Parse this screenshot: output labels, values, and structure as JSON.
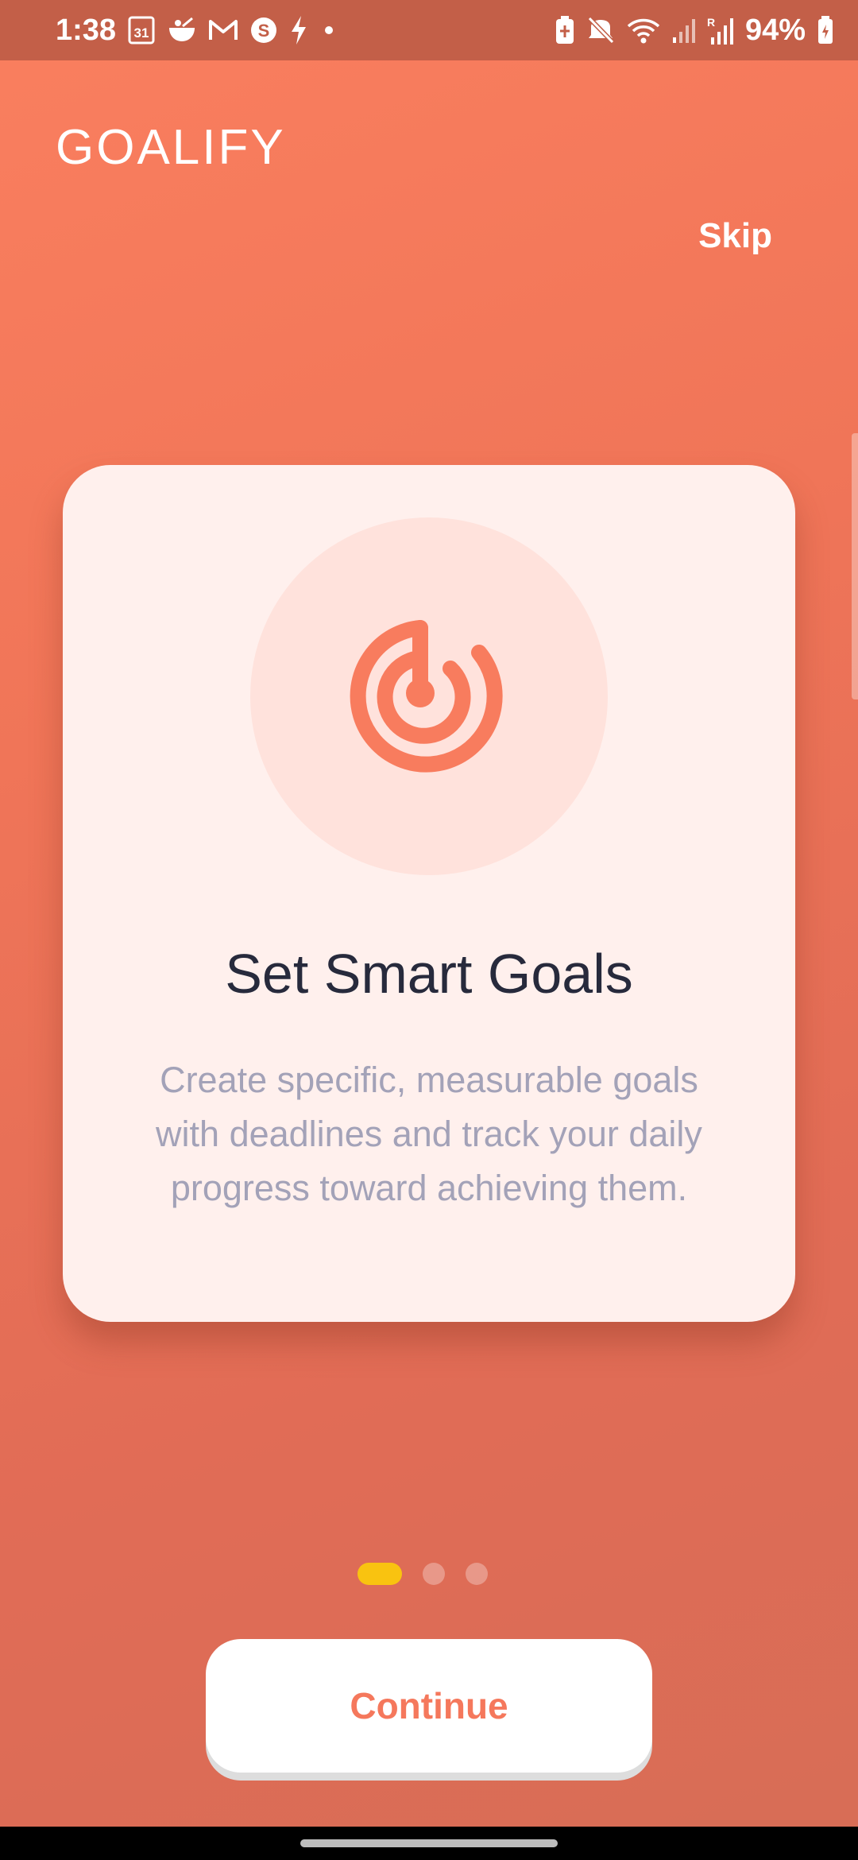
{
  "status_bar": {
    "time": "1:38",
    "calendar_day": "31",
    "battery": "94%",
    "left_icons": [
      "calendar-icon",
      "bowl-icon",
      "gmail-icon",
      "s-app-icon",
      "lightning-icon",
      "dot-icon"
    ],
    "right_icons": [
      "battery-saver-icon",
      "mute-icon",
      "wifi-icon",
      "signal-icon",
      "roaming-signal-icon",
      "battery-icon"
    ]
  },
  "app": {
    "brand": "GOALIFY",
    "skip_label": "Skip"
  },
  "card": {
    "icon": "target-icon",
    "title": "Set Smart Goals",
    "description": "Create specific, measurable goals with deadlines and track your daily progress toward achieving them."
  },
  "pagination": {
    "total": 3,
    "current": 1
  },
  "continue_label": "Continue",
  "colors": {
    "background": "#f07558",
    "status_bar": "#c35f48",
    "card_background": "#fff0ed",
    "icon_circle": "#ffe2dc",
    "accent": "#f5785c",
    "active_dot": "#f9c310",
    "title_text": "#272a3c",
    "description_text": "#a3a2b8"
  }
}
